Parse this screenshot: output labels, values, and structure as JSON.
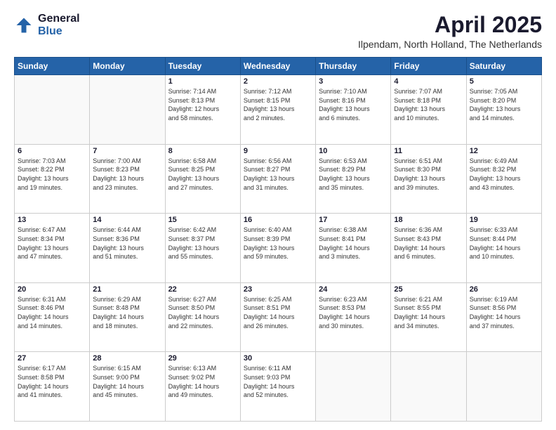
{
  "logo": {
    "general": "General",
    "blue": "Blue"
  },
  "header": {
    "month": "April 2025",
    "location": "Ilpendam, North Holland, The Netherlands"
  },
  "weekdays": [
    "Sunday",
    "Monday",
    "Tuesday",
    "Wednesday",
    "Thursday",
    "Friday",
    "Saturday"
  ],
  "weeks": [
    [
      {
        "day": "",
        "info": ""
      },
      {
        "day": "",
        "info": ""
      },
      {
        "day": "1",
        "info": "Sunrise: 7:14 AM\nSunset: 8:13 PM\nDaylight: 12 hours\nand 58 minutes."
      },
      {
        "day": "2",
        "info": "Sunrise: 7:12 AM\nSunset: 8:15 PM\nDaylight: 13 hours\nand 2 minutes."
      },
      {
        "day": "3",
        "info": "Sunrise: 7:10 AM\nSunset: 8:16 PM\nDaylight: 13 hours\nand 6 minutes."
      },
      {
        "day": "4",
        "info": "Sunrise: 7:07 AM\nSunset: 8:18 PM\nDaylight: 13 hours\nand 10 minutes."
      },
      {
        "day": "5",
        "info": "Sunrise: 7:05 AM\nSunset: 8:20 PM\nDaylight: 13 hours\nand 14 minutes."
      }
    ],
    [
      {
        "day": "6",
        "info": "Sunrise: 7:03 AM\nSunset: 8:22 PM\nDaylight: 13 hours\nand 19 minutes."
      },
      {
        "day": "7",
        "info": "Sunrise: 7:00 AM\nSunset: 8:23 PM\nDaylight: 13 hours\nand 23 minutes."
      },
      {
        "day": "8",
        "info": "Sunrise: 6:58 AM\nSunset: 8:25 PM\nDaylight: 13 hours\nand 27 minutes."
      },
      {
        "day": "9",
        "info": "Sunrise: 6:56 AM\nSunset: 8:27 PM\nDaylight: 13 hours\nand 31 minutes."
      },
      {
        "day": "10",
        "info": "Sunrise: 6:53 AM\nSunset: 8:29 PM\nDaylight: 13 hours\nand 35 minutes."
      },
      {
        "day": "11",
        "info": "Sunrise: 6:51 AM\nSunset: 8:30 PM\nDaylight: 13 hours\nand 39 minutes."
      },
      {
        "day": "12",
        "info": "Sunrise: 6:49 AM\nSunset: 8:32 PM\nDaylight: 13 hours\nand 43 minutes."
      }
    ],
    [
      {
        "day": "13",
        "info": "Sunrise: 6:47 AM\nSunset: 8:34 PM\nDaylight: 13 hours\nand 47 minutes."
      },
      {
        "day": "14",
        "info": "Sunrise: 6:44 AM\nSunset: 8:36 PM\nDaylight: 13 hours\nand 51 minutes."
      },
      {
        "day": "15",
        "info": "Sunrise: 6:42 AM\nSunset: 8:37 PM\nDaylight: 13 hours\nand 55 minutes."
      },
      {
        "day": "16",
        "info": "Sunrise: 6:40 AM\nSunset: 8:39 PM\nDaylight: 13 hours\nand 59 minutes."
      },
      {
        "day": "17",
        "info": "Sunrise: 6:38 AM\nSunset: 8:41 PM\nDaylight: 14 hours\nand 3 minutes."
      },
      {
        "day": "18",
        "info": "Sunrise: 6:36 AM\nSunset: 8:43 PM\nDaylight: 14 hours\nand 6 minutes."
      },
      {
        "day": "19",
        "info": "Sunrise: 6:33 AM\nSunset: 8:44 PM\nDaylight: 14 hours\nand 10 minutes."
      }
    ],
    [
      {
        "day": "20",
        "info": "Sunrise: 6:31 AM\nSunset: 8:46 PM\nDaylight: 14 hours\nand 14 minutes."
      },
      {
        "day": "21",
        "info": "Sunrise: 6:29 AM\nSunset: 8:48 PM\nDaylight: 14 hours\nand 18 minutes."
      },
      {
        "day": "22",
        "info": "Sunrise: 6:27 AM\nSunset: 8:50 PM\nDaylight: 14 hours\nand 22 minutes."
      },
      {
        "day": "23",
        "info": "Sunrise: 6:25 AM\nSunset: 8:51 PM\nDaylight: 14 hours\nand 26 minutes."
      },
      {
        "day": "24",
        "info": "Sunrise: 6:23 AM\nSunset: 8:53 PM\nDaylight: 14 hours\nand 30 minutes."
      },
      {
        "day": "25",
        "info": "Sunrise: 6:21 AM\nSunset: 8:55 PM\nDaylight: 14 hours\nand 34 minutes."
      },
      {
        "day": "26",
        "info": "Sunrise: 6:19 AM\nSunset: 8:56 PM\nDaylight: 14 hours\nand 37 minutes."
      }
    ],
    [
      {
        "day": "27",
        "info": "Sunrise: 6:17 AM\nSunset: 8:58 PM\nDaylight: 14 hours\nand 41 minutes."
      },
      {
        "day": "28",
        "info": "Sunrise: 6:15 AM\nSunset: 9:00 PM\nDaylight: 14 hours\nand 45 minutes."
      },
      {
        "day": "29",
        "info": "Sunrise: 6:13 AM\nSunset: 9:02 PM\nDaylight: 14 hours\nand 49 minutes."
      },
      {
        "day": "30",
        "info": "Sunrise: 6:11 AM\nSunset: 9:03 PM\nDaylight: 14 hours\nand 52 minutes."
      },
      {
        "day": "",
        "info": ""
      },
      {
        "day": "",
        "info": ""
      },
      {
        "day": "",
        "info": ""
      }
    ]
  ]
}
